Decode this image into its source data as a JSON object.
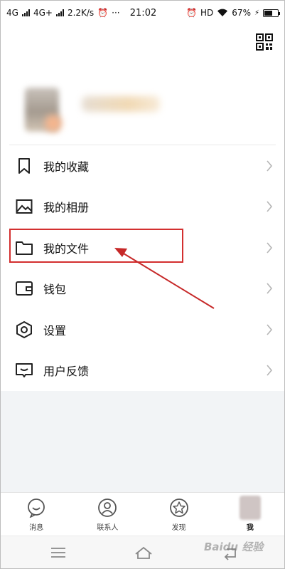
{
  "status_bar": {
    "left_text_1": "4G",
    "left_text_2": "4G+",
    "speed": "2.2K/s",
    "more": "···",
    "time": "21:02",
    "hd": "HD",
    "battery": "67%",
    "battery_level": 0.67
  },
  "menu": {
    "items": [
      {
        "label": "我的收藏",
        "icon": "bookmark-icon"
      },
      {
        "label": "我的相册",
        "icon": "photo-icon"
      },
      {
        "label": "我的文件",
        "icon": "folder-icon"
      },
      {
        "label": "钱包",
        "icon": "wallet-icon"
      },
      {
        "label": "设置",
        "icon": "settings-icon"
      },
      {
        "label": "用户反馈",
        "icon": "feedback-icon"
      }
    ]
  },
  "tabs": [
    {
      "label": "消息",
      "icon": "message-icon"
    },
    {
      "label": "联系人",
      "icon": "contacts-icon"
    },
    {
      "label": "发现",
      "icon": "discover-icon"
    },
    {
      "label": "我",
      "icon": "avatar",
      "active": true
    }
  ],
  "watermark": "Baidu 经验",
  "colors": {
    "highlight": "#d32f2f",
    "arrow": "#c62828",
    "background_gray": "#f2f4f6"
  }
}
